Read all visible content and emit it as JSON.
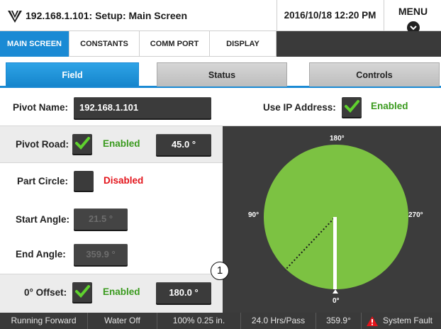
{
  "header": {
    "title": "192.168.1.101: Setup: Main Screen",
    "datetime": "2016/10/18 12:20 PM",
    "menu_label": "MENU",
    "logo_icon": "valley-logo-icon"
  },
  "top_tabs": [
    {
      "label": "MAIN SCREEN",
      "active": true
    },
    {
      "label": "CONSTANTS",
      "active": false
    },
    {
      "label": "COMM PORT",
      "active": false
    },
    {
      "label": "DISPLAY",
      "active": false
    }
  ],
  "sub_tabs": [
    {
      "label": "Field",
      "active": true
    },
    {
      "label": "Status",
      "active": false
    },
    {
      "label": "Controls",
      "active": false
    }
  ],
  "form": {
    "pivot_name": {
      "label": "Pivot Name:",
      "value": "192.168.1.101"
    },
    "use_ip": {
      "label": "Use IP Address:",
      "checked": true,
      "status": "Enabled"
    },
    "pivot_road": {
      "label": "Pivot Road:",
      "checked": true,
      "status": "Enabled",
      "value": "45.0 °"
    },
    "part_circle": {
      "label": "Part Circle:",
      "checked": false,
      "status": "Disabled"
    },
    "start_angle": {
      "label": "Start Angle:",
      "value": "21.5 °"
    },
    "end_angle": {
      "label": "End Angle:",
      "value": "359.9 °"
    },
    "offset": {
      "label": "0° Offset:",
      "checked": true,
      "status": "Enabled",
      "value": "180.0 °"
    }
  },
  "pivot_view": {
    "labels": {
      "top": "180°",
      "left": "90°",
      "right": "270°",
      "bottom": "0°"
    },
    "callout": "1",
    "colors": {
      "field": "#7cc242",
      "background": "#3c3c3c",
      "arm": "#ffffff"
    }
  },
  "status_bar": {
    "direction": "Running Forward",
    "water": "Water Off",
    "speed": "100% 0.25 in.",
    "hours": "24.0 Hrs/Pass",
    "angle": "359.9°",
    "fault": "System Fault"
  },
  "colors": {
    "accent": "#1a8ad4",
    "enabled": "#3a9a1e",
    "disabled": "#e3141b"
  }
}
